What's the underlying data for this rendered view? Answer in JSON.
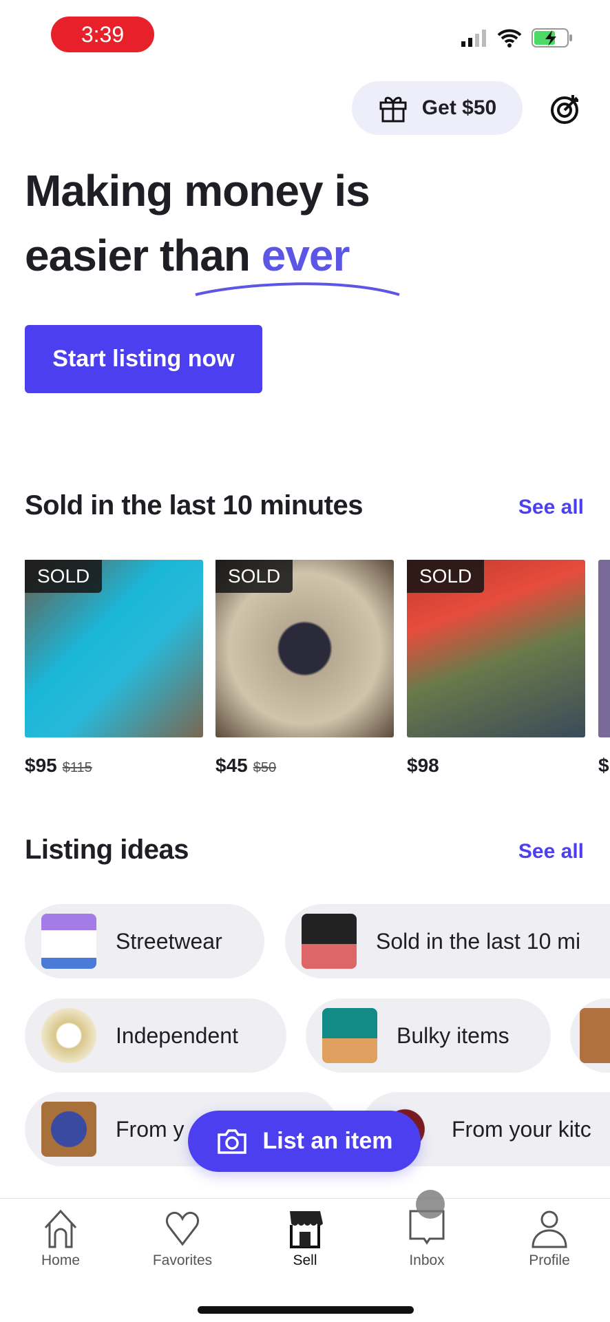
{
  "status_bar": {
    "time": "3:39"
  },
  "header": {
    "referral_label": "Get $50",
    "referral_icon": "gift-icon",
    "goals_icon": "target-icon"
  },
  "hero": {
    "line1": "Making money is",
    "line2_prefix": "easier than ",
    "line2_accent": "ever",
    "cta": "Start listing now"
  },
  "sold_section": {
    "title": "Sold in the last 10 minutes",
    "see_all": "See all",
    "badge": "SOLD",
    "items": [
      {
        "price": "$95",
        "original": "$115"
      },
      {
        "price": "$45",
        "original": "$50"
      },
      {
        "price": "$98",
        "original": ""
      },
      {
        "price": "$",
        "original": ""
      }
    ]
  },
  "ideas_section": {
    "title": "Listing ideas",
    "see_all": "See all",
    "chips": [
      [
        "Streetwear",
        "Sold in the last 10 mi"
      ],
      [
        "Independent",
        "Bulky items",
        ""
      ],
      [
        "From y",
        "From your kitc"
      ]
    ]
  },
  "fab": {
    "label": "List an item",
    "icon": "camera-icon"
  },
  "tabs": [
    {
      "label": "Home",
      "icon": "home-icon"
    },
    {
      "label": "Favorites",
      "icon": "heart-icon"
    },
    {
      "label": "Sell",
      "icon": "storefront-icon",
      "active": true
    },
    {
      "label": "Inbox",
      "icon": "inbox-icon"
    },
    {
      "label": "Profile",
      "icon": "person-icon"
    }
  ],
  "colors": {
    "accent": "#4b3ff0",
    "time_pill": "#e8202a",
    "chip_bg": "#eeeef3"
  }
}
